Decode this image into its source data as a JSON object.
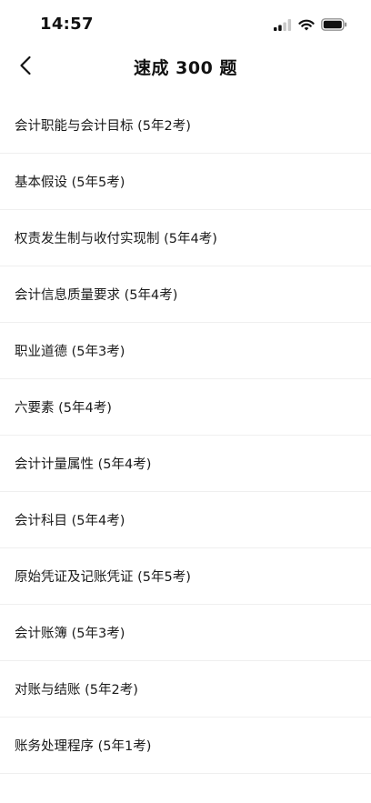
{
  "status_bar": {
    "time": "14:57",
    "icons": [
      "cellular-signal-icon",
      "wifi-icon",
      "battery-icon"
    ]
  },
  "header": {
    "title": "速成 300 题",
    "back_icon": "chevron-left-icon"
  },
  "topics": [
    {
      "label": "会计职能与会计目标 (5年2考)"
    },
    {
      "label": "基本假设 (5年5考)"
    },
    {
      "label": "权责发生制与收付实现制 (5年4考)"
    },
    {
      "label": "会计信息质量要求 (5年4考)"
    },
    {
      "label": "职业道德 (5年3考)"
    },
    {
      "label": "六要素 (5年4考)"
    },
    {
      "label": "会计计量属性 (5年4考)"
    },
    {
      "label": "会计科目 (5年4考)"
    },
    {
      "label": "原始凭证及记账凭证 (5年5考)"
    },
    {
      "label": "会计账簿 (5年3考)"
    },
    {
      "label": "对账与结账 (5年2考)"
    },
    {
      "label": "账务处理程序 (5年1考)"
    }
  ]
}
